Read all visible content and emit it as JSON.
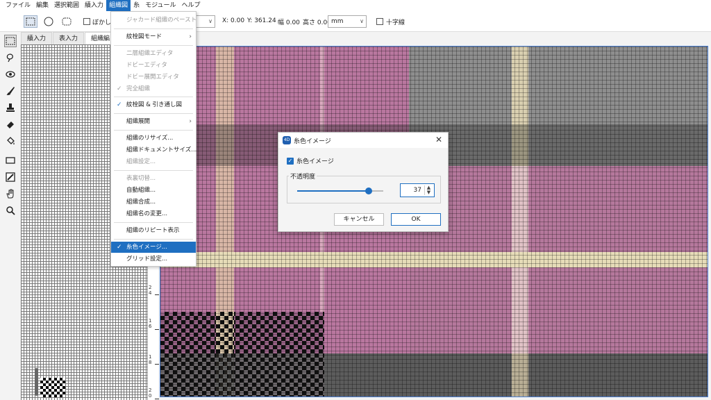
{
  "menubar": {
    "items": [
      "ファイル",
      "編集",
      "選択範囲",
      "績入力",
      "組織図",
      "糸",
      "モジュール",
      "ヘルプ"
    ],
    "active_index": 4
  },
  "options_bar": {
    "blur_label": "ぼかし",
    "x_readout": "X: 0.00",
    "y_readout": "Y: 361.24",
    "width_readout": "幅 0.00",
    "height_readout": "高さ 0.00",
    "unit": "mm",
    "crosshair_label": "十字線"
  },
  "tabs": [
    "績入力",
    "表入力",
    "組織編"
  ],
  "ruler_labels": [
    "2",
    "4",
    "1",
    "6",
    "1",
    "8",
    "2",
    "0"
  ],
  "dropdown": {
    "items": [
      {
        "label": "ジャカード組織のペースト",
        "disabled": true
      },
      {
        "label": "紋栓図モード",
        "submenu": true
      },
      {
        "label": "二層組織エディタ",
        "disabled": true
      },
      {
        "label": "ドビーエディタ",
        "disabled": true
      },
      {
        "label": "ドビー展開エディタ",
        "disabled": true
      },
      {
        "label": "完全組織",
        "disabled": true,
        "checked": true
      },
      {
        "label": "紋栓図 & 引き通し図",
        "checked": true
      },
      {
        "label": "組織展開",
        "submenu": true
      },
      {
        "label": "組織のリサイズ..."
      },
      {
        "label": "組織ドキュメントサイズ..."
      },
      {
        "label": "組織設定...",
        "disabled": true
      },
      {
        "label": "表裏切替...",
        "disabled": true
      },
      {
        "label": "自動組織..."
      },
      {
        "label": "組織合成..."
      },
      {
        "label": "組織名の変更..."
      },
      {
        "label": "組織のリピート表示"
      },
      {
        "label": "糸色イメージ...",
        "checked": true,
        "highlighted": true
      },
      {
        "label": "グリッド設定..."
      }
    ]
  },
  "dialog": {
    "icon_text": "4D",
    "title": "糸色イメージ",
    "checkbox_label": "糸色イメージ",
    "checkbox_checked": true,
    "group_label": "不透明度",
    "opacity_value": "37",
    "slider_fraction": 0.83,
    "cancel_label": "キャンセル",
    "ok_label": "OK"
  },
  "colors": {
    "accent": "#1f6fc1",
    "pink": "#b9779f",
    "pink_light": "#d9a6c0",
    "gray": "#8e8e8e",
    "gray_dark": "#5c5c5c",
    "cream": "#e6dcb8"
  }
}
